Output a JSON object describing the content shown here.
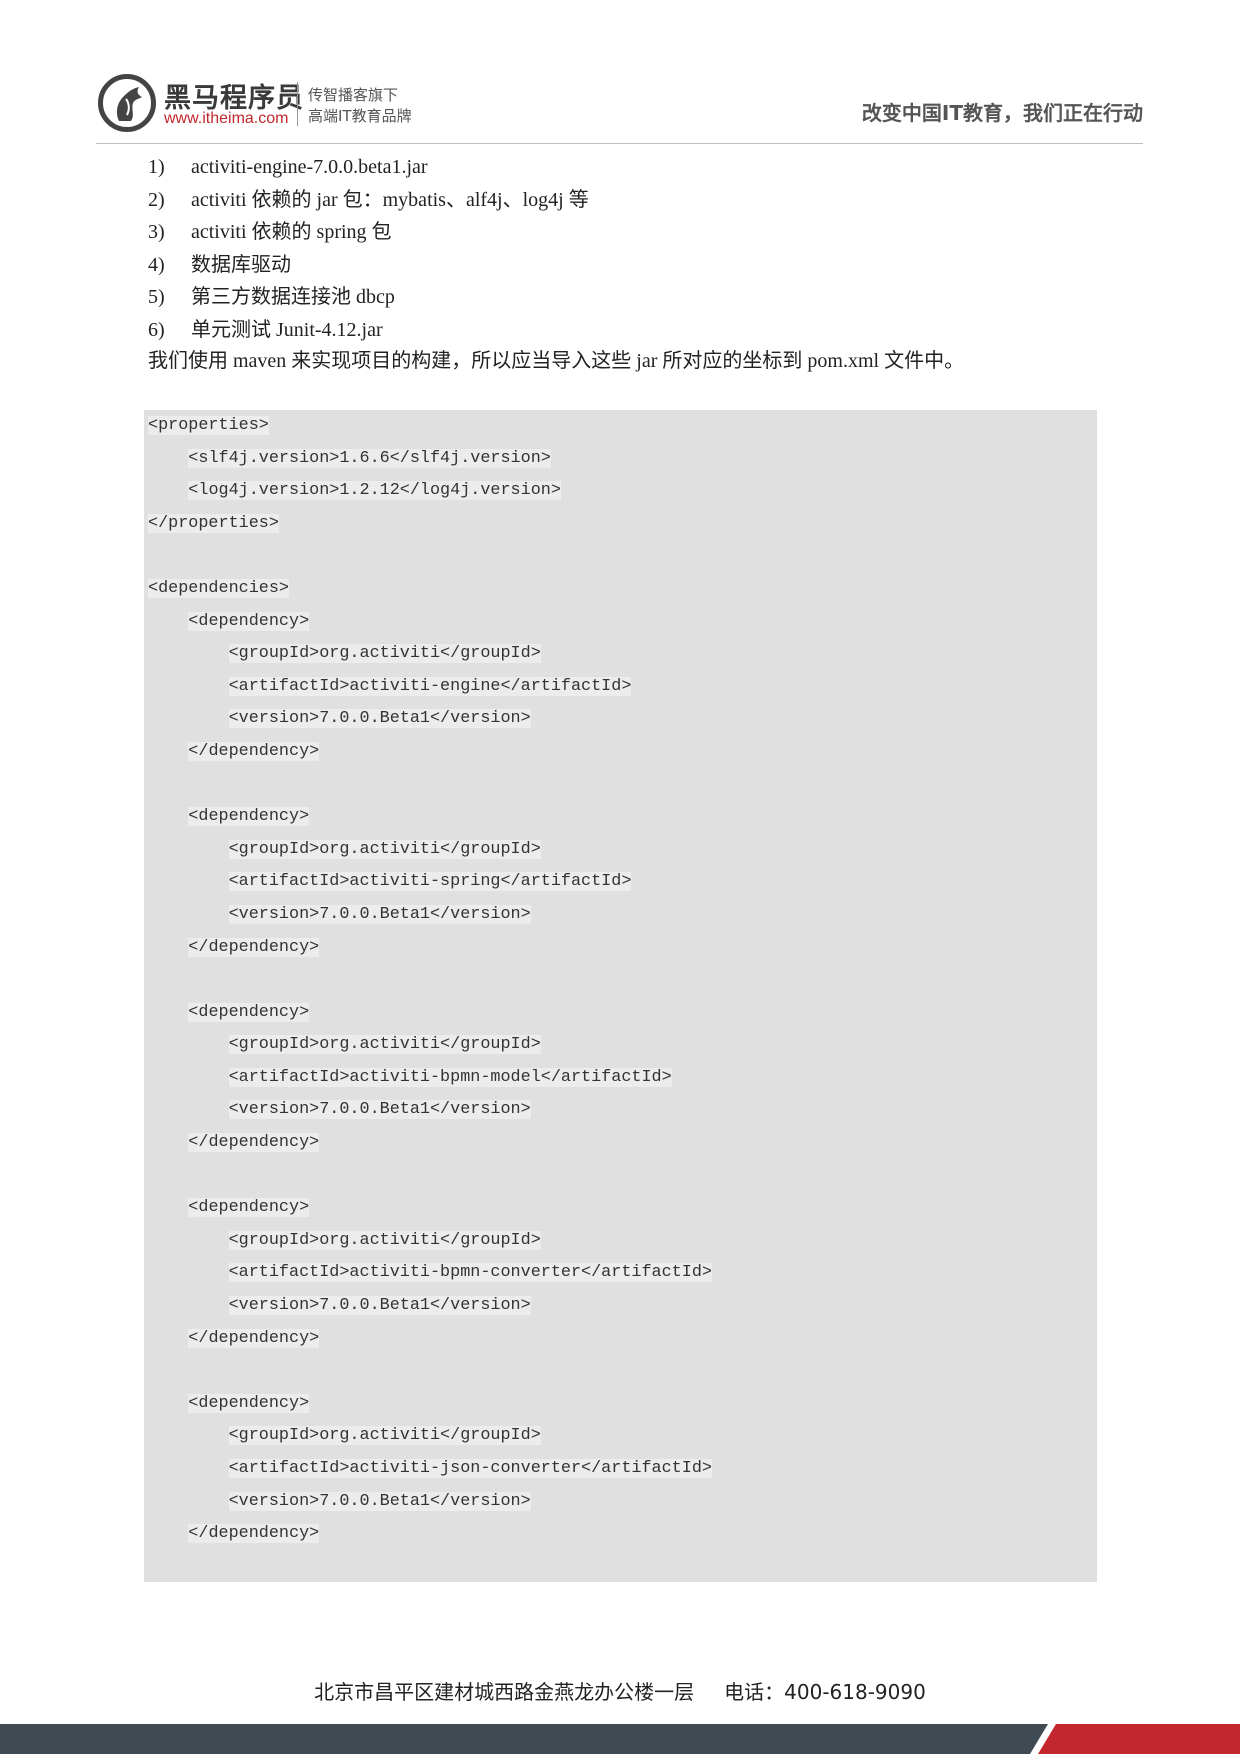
{
  "header": {
    "brand_name": "黑马程序员",
    "brand_url": "www.itheima.com",
    "tagline_1": "传智播客旗下",
    "tagline_2": "高端IT教育品牌",
    "slogan": "改变中国IT教育，我们正在行动"
  },
  "list": [
    {
      "num": "1)",
      "text": "activiti-engine-7.0.0.beta1.jar"
    },
    {
      "num": "2)",
      "text": "activiti 依赖的 jar 包：mybatis、alf4j、log4j 等"
    },
    {
      "num": "3)",
      "text": "activiti 依赖的 spring 包"
    },
    {
      "num": "4)",
      "text": "数据库驱动"
    },
    {
      "num": "5)",
      "text": "第三方数据连接池 dbcp"
    },
    {
      "num": "6)",
      "text": "单元测试 Junit-4.12.jar"
    }
  ],
  "paragraph": "我们使用 maven 来实现项目的构建，所以应当导入这些 jar 所对应的坐标到 pom.xml 文件中。",
  "code_lines": [
    "<properties>",
    "    <slf4j.version>1.6.6</slf4j.version>",
    "    <log4j.version>1.2.12</log4j.version>",
    "</properties>",
    "",
    "<dependencies>",
    "    <dependency>",
    "        <groupId>org.activiti</groupId>",
    "        <artifactId>activiti-engine</artifactId>",
    "        <version>7.0.0.Beta1</version>",
    "    </dependency>",
    "",
    "    <dependency>",
    "        <groupId>org.activiti</groupId>",
    "        <artifactId>activiti-spring</artifactId>",
    "        <version>7.0.0.Beta1</version>",
    "    </dependency>",
    "",
    "    <dependency>",
    "        <groupId>org.activiti</groupId>",
    "        <artifactId>activiti-bpmn-model</artifactId>",
    "        <version>7.0.0.Beta1</version>",
    "    </dependency>",
    "",
    "    <dependency>",
    "        <groupId>org.activiti</groupId>",
    "        <artifactId>activiti-bpmn-converter</artifactId>",
    "        <version>7.0.0.Beta1</version>",
    "    </dependency>",
    "",
    "    <dependency>",
    "        <groupId>org.activiti</groupId>",
    "        <artifactId>activiti-json-converter</artifactId>",
    "        <version>7.0.0.Beta1</version>",
    "    </dependency>"
  ],
  "footer": {
    "address": "北京市昌平区建材城西路金燕龙办公楼一层",
    "phone": "电话：400-618-9090"
  },
  "colors": {
    "brand_red": "#c2272d",
    "code_bg": "#e0e0e0",
    "footer_bar": "#3f4a52"
  }
}
